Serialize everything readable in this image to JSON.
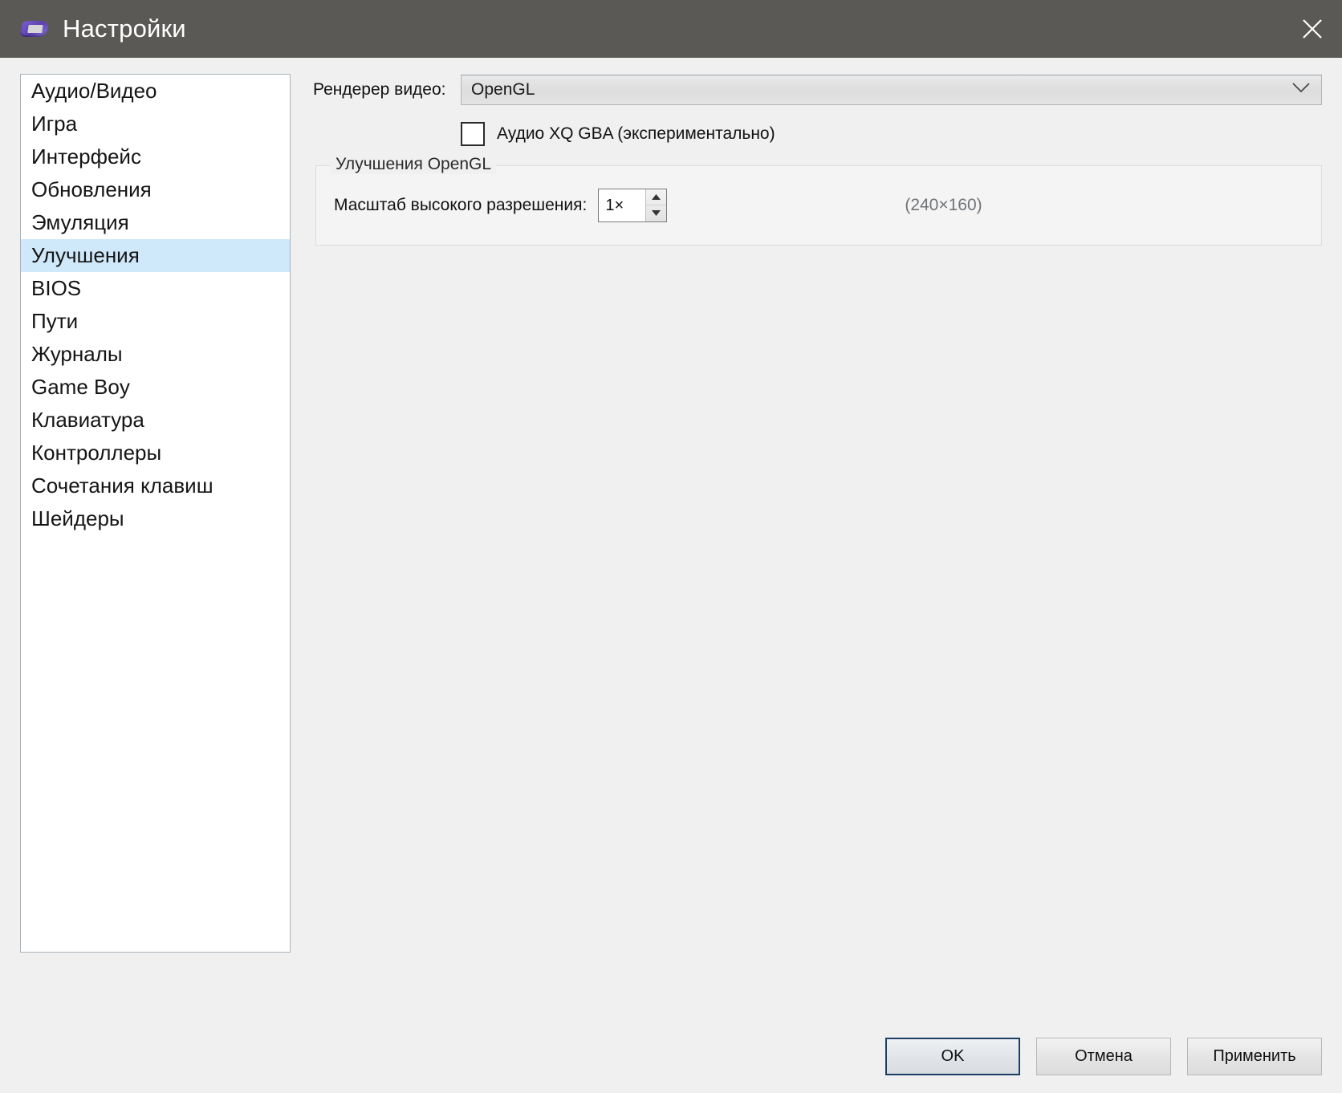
{
  "window": {
    "title": "Настройки",
    "icon": "gba-console-icon",
    "close_icon": "close-icon",
    "titlebar_color": "#5b5955",
    "body_color": "#f0f0f0"
  },
  "sidebar": {
    "selected_index": 5,
    "selection_color": "#cfe8fa",
    "items": [
      {
        "label": "Аудио/Видео"
      },
      {
        "label": "Игра"
      },
      {
        "label": "Интерфейс"
      },
      {
        "label": "Обновления"
      },
      {
        "label": "Эмуляция"
      },
      {
        "label": "Улучшения"
      },
      {
        "label": "BIOS"
      },
      {
        "label": "Пути"
      },
      {
        "label": "Журналы"
      },
      {
        "label": "Game Boy"
      },
      {
        "label": "Клавиатура"
      },
      {
        "label": "Контроллеры"
      },
      {
        "label": "Сочетания клавиш"
      },
      {
        "label": "Шейдеры"
      }
    ]
  },
  "main": {
    "renderer": {
      "label": "Рендерер видео:",
      "value": "OpenGL",
      "arrow_icon": "chevron-down-icon"
    },
    "audio_xq": {
      "label": "Аудио XQ GBA (экспериментально)",
      "checked": false
    },
    "opengl_group": {
      "title": "Улучшения OpenGL",
      "scale": {
        "label": "Масштаб высокого разрешения:",
        "value": "1×",
        "up_icon": "spinner-up-icon",
        "down_icon": "spinner-down-icon"
      },
      "resolution": "(240×160)"
    }
  },
  "footer": {
    "ok_label": "OK",
    "cancel_label": "Отмена",
    "apply_label": "Применить",
    "default_button_border": "#1d3f66"
  }
}
